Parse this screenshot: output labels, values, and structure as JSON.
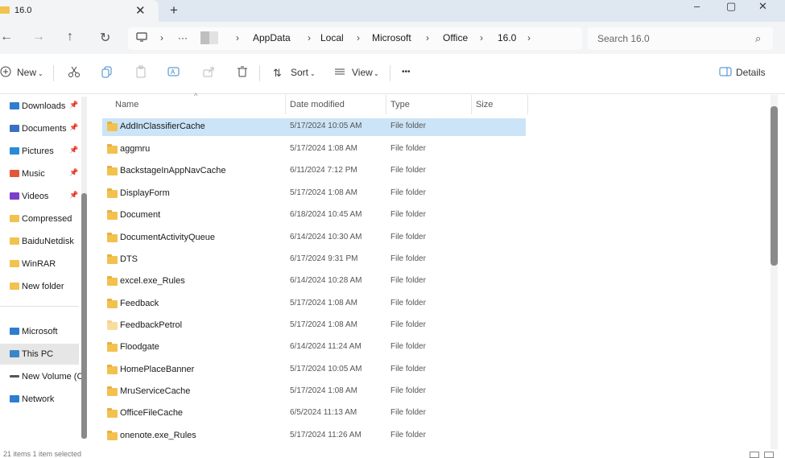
{
  "tab": {
    "title": "16.0",
    "close": "✕",
    "new": "+"
  },
  "window": {
    "minimize": "–",
    "maximize": "▢",
    "close": "✕"
  },
  "nav": {
    "back": "←",
    "forward": "→",
    "up": "↑",
    "refresh": "↻"
  },
  "address": {
    "monitor_icon": "monitor-icon",
    "more": "···",
    "crumbs": [
      "AppData",
      "Local",
      "Microsoft",
      "Office",
      "16.0"
    ],
    "sep": "›"
  },
  "search": {
    "placeholder": "Search 16.0",
    "icon": "⌕"
  },
  "commands": {
    "new_label": "New",
    "sort_label": "Sort",
    "view_label": "View",
    "more": "•••",
    "details_label": "Details",
    "icons": [
      "cut-icon",
      "copy-icon",
      "paste-icon",
      "rename-icon",
      "share-icon",
      "delete-icon"
    ]
  },
  "sidebar": {
    "items": [
      {
        "label": "Downloads",
        "color": "#2e7dd1",
        "pinned": true
      },
      {
        "label": "Documents",
        "color": "#3a6fc4",
        "pinned": true
      },
      {
        "label": "Pictures",
        "color": "#2b8ad8",
        "pinned": true
      },
      {
        "label": "Music",
        "color": "#e2563a",
        "pinned": true
      },
      {
        "label": "Videos",
        "color": "#7b3fc9",
        "pinned": true
      },
      {
        "label": "Compressed",
        "color": "#f2c24f",
        "pinned": false
      },
      {
        "label": "BaiduNetdisk",
        "color": "#f2c24f",
        "pinned": false
      },
      {
        "label": "WinRAR",
        "color": "#f2c24f",
        "pinned": false
      },
      {
        "label": "New folder",
        "color": "#f2c24f",
        "pinned": false
      }
    ],
    "locations": [
      {
        "label": "Microsoft",
        "color": "#2e7dd1"
      },
      {
        "label": "This PC",
        "color": "#3a86c8"
      },
      {
        "label": "New Volume (C:)",
        "color": "#555555"
      },
      {
        "label": "Network",
        "color": "#2e7dd1"
      }
    ],
    "pin_glyph": "📌"
  },
  "columns": {
    "name": "Name",
    "date": "Date modified",
    "type": "Type",
    "size": "Size",
    "sort_caret": "^"
  },
  "files": [
    {
      "name": "AddInClassifierCache",
      "date": "5/17/2024 10:05 AM",
      "type": "File folder"
    },
    {
      "name": "aggmru",
      "date": "5/17/2024 1:08 AM",
      "type": "File folder"
    },
    {
      "name": "BackstageInAppNavCache",
      "date": "6/11/2024 7:12 PM",
      "type": "File folder"
    },
    {
      "name": "DisplayForm",
      "date": "5/17/2024 1:08 AM",
      "type": "File folder"
    },
    {
      "name": "Document",
      "date": "6/18/2024 10:45 AM",
      "type": "File folder"
    },
    {
      "name": "DocumentActivityQueue",
      "date": "6/14/2024 10:30 AM",
      "type": "File folder"
    },
    {
      "name": "DTS",
      "date": "6/17/2024 9:31 PM",
      "type": "File folder"
    },
    {
      "name": "excel.exe_Rules",
      "date": "6/14/2024 10:28 AM",
      "type": "File folder"
    },
    {
      "name": "Feedback",
      "date": "5/17/2024 1:08 AM",
      "type": "File folder"
    },
    {
      "name": "FeedbackPetrol",
      "date": "5/17/2024 1:08 AM",
      "type": "File folder"
    },
    {
      "name": "Floodgate",
      "date": "6/14/2024 11:24 AM",
      "type": "File folder"
    },
    {
      "name": "HomePlaceBanner",
      "date": "5/17/2024 10:05 AM",
      "type": "File folder"
    },
    {
      "name": "MruServiceCache",
      "date": "5/17/2024 1:08 AM",
      "type": "File folder"
    },
    {
      "name": "OfficeFileCache",
      "date": "6/5/2024 11:13 AM",
      "type": "File folder"
    },
    {
      "name": "onenote.exe_Rules",
      "date": "5/17/2024 11:26 AM",
      "type": "File folder"
    }
  ],
  "status": {
    "text": "21 items   1 item selected"
  },
  "colors": {
    "selection": "#cce4f7",
    "folder": "#f2c24f",
    "tabbar": "#dfe7f1"
  }
}
